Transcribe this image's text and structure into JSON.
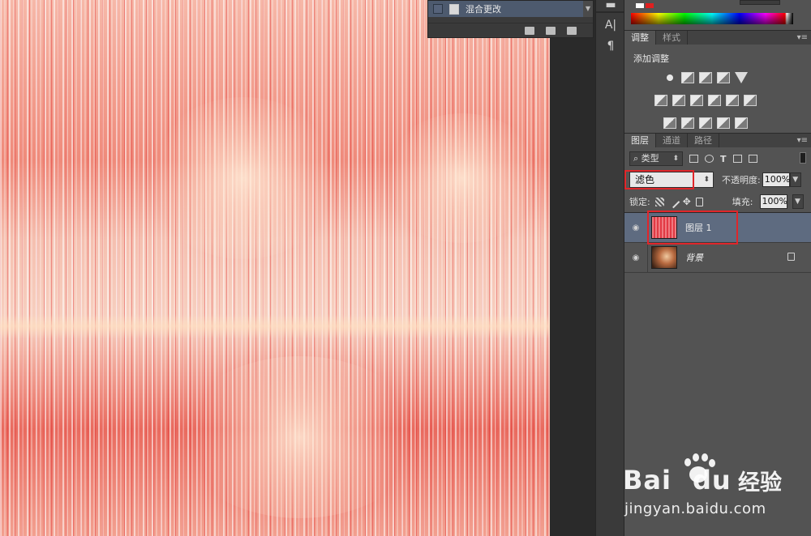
{
  "history": {
    "step_label": "混合更改"
  },
  "tool_strip": {
    "items": [
      {
        "icon": "text-tool-icon",
        "glyph": "A|"
      },
      {
        "icon": "paragraph-icon",
        "glyph": "¶"
      }
    ]
  },
  "adjustments": {
    "tabs": [
      {
        "label": "调整",
        "active": true
      },
      {
        "label": "样式",
        "active": false
      }
    ],
    "title": "添加调整",
    "rows": [
      [
        "brightness-icon",
        "levels-icon",
        "curves-icon",
        "exposure-icon",
        "gradient-triangle-icon"
      ],
      [
        "vibrance-icon",
        "balance-icon",
        "bw-icon",
        "photo-filter-icon",
        "mixer-icon",
        "grid-icon"
      ],
      [
        "invert-icon",
        "posterize-icon",
        "threshold-icon",
        "selective-color-icon",
        "gradient-map-icon"
      ]
    ]
  },
  "layers": {
    "tabs": [
      {
        "label": "图层",
        "active": true
      },
      {
        "label": "通道",
        "active": false
      },
      {
        "label": "路径",
        "active": false
      }
    ],
    "filter_kind": "类型",
    "blend_mode": "滤色",
    "opacity_label": "不透明度:",
    "opacity_value": "100%",
    "lock_label": "锁定:",
    "fill_label": "填充:",
    "fill_value": "100%",
    "items": [
      {
        "name": "图层 1",
        "selected": true,
        "italic": false,
        "locked": false
      },
      {
        "name": "背景",
        "selected": false,
        "italic": true,
        "locked": true
      }
    ]
  },
  "watermark": {
    "brand": "Bai",
    "brand_tail": "du",
    "brand_cn": "经验",
    "url": "jingyan.baidu.com"
  },
  "colors": {
    "highlight": "#e0262a",
    "selected_layer": "#5e6b80"
  }
}
